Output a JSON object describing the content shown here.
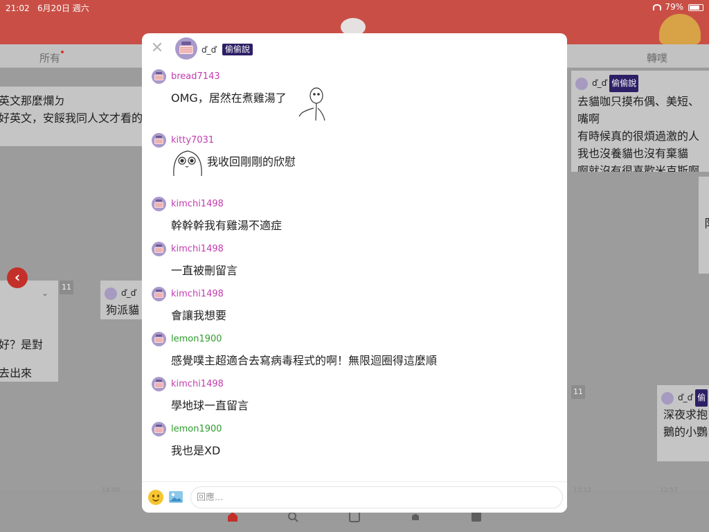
{
  "status_bar": {
    "time": "21:02",
    "date": "6月20日 週六",
    "battery_text": "79%",
    "battery_level": 0.79
  },
  "tabs": [
    {
      "label": "所有"
    },
    {
      "label": "轉噗"
    }
  ],
  "timeline": {
    "cards": [
      {
        "lines": [
          "英文那麼爛ㄉ",
          "好英文，安餒我同人文才看的"
        ]
      },
      {
        "header_name": "ď_ď",
        "header_tag": "偷偷說",
        "lines": [
          "去貓咖只摸布偶、美短、",
          "嘴啊",
          "有時候真的很煩過激的人",
          "我也沒養貓也沒有棄貓",
          "啊就沒有很喜歡米克斯啊"
        ]
      },
      {
        "lines": [
          "好？是對",
          "去出來"
        ]
      },
      {
        "header_name": "ď_ď",
        "lines": [
          "狗派貓"
        ]
      },
      {
        "header_name": "ď_ď",
        "header_tag": "偷",
        "lines": [
          "深夜求抱",
          "鵝的小鸚"
        ]
      },
      {
        "lines": [
          "阝"
        ]
      }
    ],
    "counts": [
      "11",
      "11"
    ],
    "times": [
      "14:00",
      "13:12",
      "12:57"
    ]
  },
  "modal": {
    "poster_name": "ď_ď",
    "poster_tag": "偷偷說",
    "close_symbol": "✕",
    "comments": [
      {
        "user": "bread7143",
        "text": "OMG，居然在煮雞湯了",
        "sticker": "sticker-thinking",
        "color": "purple"
      },
      {
        "user": "kitty7031",
        "text": "我收回剛剛的欣慰",
        "sticker": "sticker-shocked-face",
        "color": "purple"
      },
      {
        "user": "kimchi1498",
        "text": "幹幹幹我有雞湯不適症",
        "color": "purple"
      },
      {
        "user": "kimchi1498",
        "text": "一直被刪留言",
        "color": "purple"
      },
      {
        "user": "kimchi1498",
        "text": "會讓我想要",
        "color": "purple"
      },
      {
        "user": "lemon1900",
        "text": "感覺噗主超適合去寫病毒程式的啊！無限迴圈得這麼順",
        "color": "green"
      },
      {
        "user": "kimchi1498",
        "text": "學地球一直留言",
        "color": "purple"
      },
      {
        "user": "lemon1900",
        "text": "我也是XD",
        "color": "green"
      }
    ],
    "reply": {
      "placeholder": "回應..."
    }
  },
  "colors": {
    "brand": "#c94f46",
    "tag": "#2d1f66",
    "user_purple": "#c33bb0",
    "user_green": "#2e9b2e"
  },
  "icons": [
    "wifi-icon",
    "battery-icon",
    "close-icon",
    "emoji-icon",
    "image-icon",
    "home-icon",
    "search-icon",
    "edit-icon",
    "bell-icon",
    "profile-icon",
    "back-arrow-icon"
  ]
}
